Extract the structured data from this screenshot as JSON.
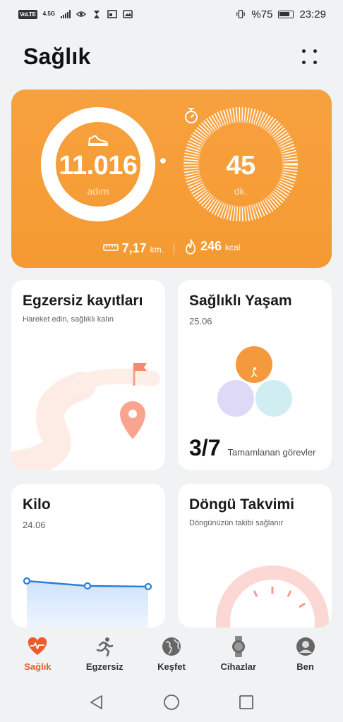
{
  "status_bar": {
    "volte": "VoLTE",
    "network": "4.5G",
    "battery_percent": "%75",
    "time": "23:29"
  },
  "header": {
    "title": "Sağlık"
  },
  "activity": {
    "steps_value": "11.016",
    "steps_unit": "adım",
    "minutes_value": "45",
    "minutes_unit": "dk.",
    "distance_value": "7,17",
    "distance_unit": "km.",
    "calories_value": "246",
    "calories_unit": "kcal",
    "accent_color": "#f59a32"
  },
  "cards": {
    "exercise": {
      "title": "Egzersiz kayıtları",
      "subtitle": "Hareket edin, sağlıklı kalın"
    },
    "healthy": {
      "title": "Sağlıklı Yaşam",
      "date": "25.06",
      "count": "3/7",
      "label": "Tamamlanan görevler"
    },
    "weight": {
      "title": "Kilo",
      "date": "24.06"
    },
    "cycle": {
      "title": "Döngü Takvimi",
      "subtitle": "Döngünüzün takibi sağlanır"
    }
  },
  "bottom_nav": {
    "items": [
      {
        "label": "Sağlık",
        "icon": "heart-pulse-icon",
        "active": true
      },
      {
        "label": "Egzersiz",
        "icon": "running-icon",
        "active": false
      },
      {
        "label": "Keşfet",
        "icon": "globe-icon",
        "active": false
      },
      {
        "label": "Cihazlar",
        "icon": "watch-icon",
        "active": false
      },
      {
        "label": "Ben",
        "icon": "person-icon",
        "active": false
      }
    ],
    "active_color": "#f0592b"
  }
}
